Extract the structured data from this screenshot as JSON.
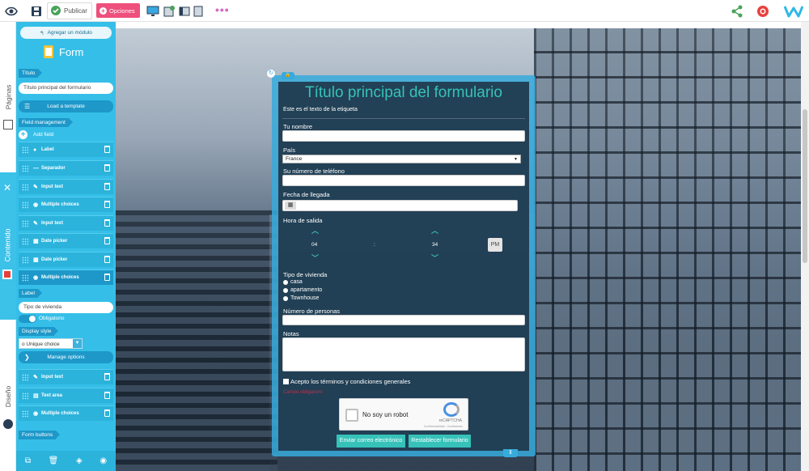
{
  "toolbar": {
    "publish_label": "Publicar",
    "options_label": "Opciones",
    "more_label": "•••",
    "icons": [
      "eye-icon",
      "save-icon",
      "publish-check-icon",
      "desktop-icon",
      "tablet-icon",
      "window-icon",
      "mobile-icon",
      "share-icon",
      "help-lifebuoy-icon",
      "brand-logo-icon"
    ]
  },
  "sidetabs": {
    "pages": "Páginas",
    "content": "Contenido",
    "design": "Diseño"
  },
  "panel": {
    "add_module": "Agregar un módulo",
    "module_title": "Form",
    "title_tag": "Título",
    "title_value": "Título principal del formulario",
    "load_template": "Load a template",
    "field_management_tag": "Field management",
    "add_field": "Add field",
    "fields": [
      {
        "label": "Label",
        "icon": "label-icon"
      },
      {
        "label": "Separador",
        "icon": "separator-icon"
      },
      {
        "label": "Input text",
        "icon": "pencil-icon"
      },
      {
        "label": "Multiple choices",
        "icon": "radio-icon"
      },
      {
        "label": "Input text",
        "icon": "pencil-icon"
      },
      {
        "label": "Date picker",
        "icon": "calendar-icon"
      },
      {
        "label": "Date picker",
        "icon": "calendar-icon"
      },
      {
        "label": "Multiple choices",
        "icon": "radio-icon"
      }
    ],
    "label_tag": "Label",
    "label_value": "Tipo de vivienda",
    "obligatorio": "Obligatorio",
    "display_style_tag": "Display style",
    "display_style_value": "o Unique choice",
    "manage_options": "Manage options",
    "fields_after": [
      {
        "label": "Input text",
        "icon": "pencil-icon"
      },
      {
        "label": "Text area",
        "icon": "textarea-icon"
      },
      {
        "label": "Multiple choices",
        "icon": "radio-icon"
      }
    ],
    "form_buttons_tag": "Form buttons"
  },
  "form": {
    "title": "Título principal del formulario",
    "tag_text": "Este es el texto de la etiqueta",
    "name_label": "Tu nombre",
    "country_label": "País",
    "country_value": "France",
    "phone_label": "Su número de teléfono",
    "arrival_label": "Fecha de llegada",
    "departure_label": "Hora de salida",
    "hour": "04",
    "sep": ":",
    "minute": "34",
    "ampm": "PM",
    "housing_label": "Tipo de vivienda",
    "housing_options": [
      "casa",
      "apartamento",
      "Townhouse"
    ],
    "persons_label": "Número de personas",
    "notes_label": "Notas",
    "accept_label": "Acepto los términos y condiciones generales",
    "required_text": "Campo obligatorio",
    "captcha_text": "No soy un robot",
    "captcha_brand": "reCAPTCHA",
    "captcha_links": "Confidencialidad - Condiciones",
    "send_button": "Enviar correo electrónico",
    "reset_button": "Restablecer formulario"
  }
}
